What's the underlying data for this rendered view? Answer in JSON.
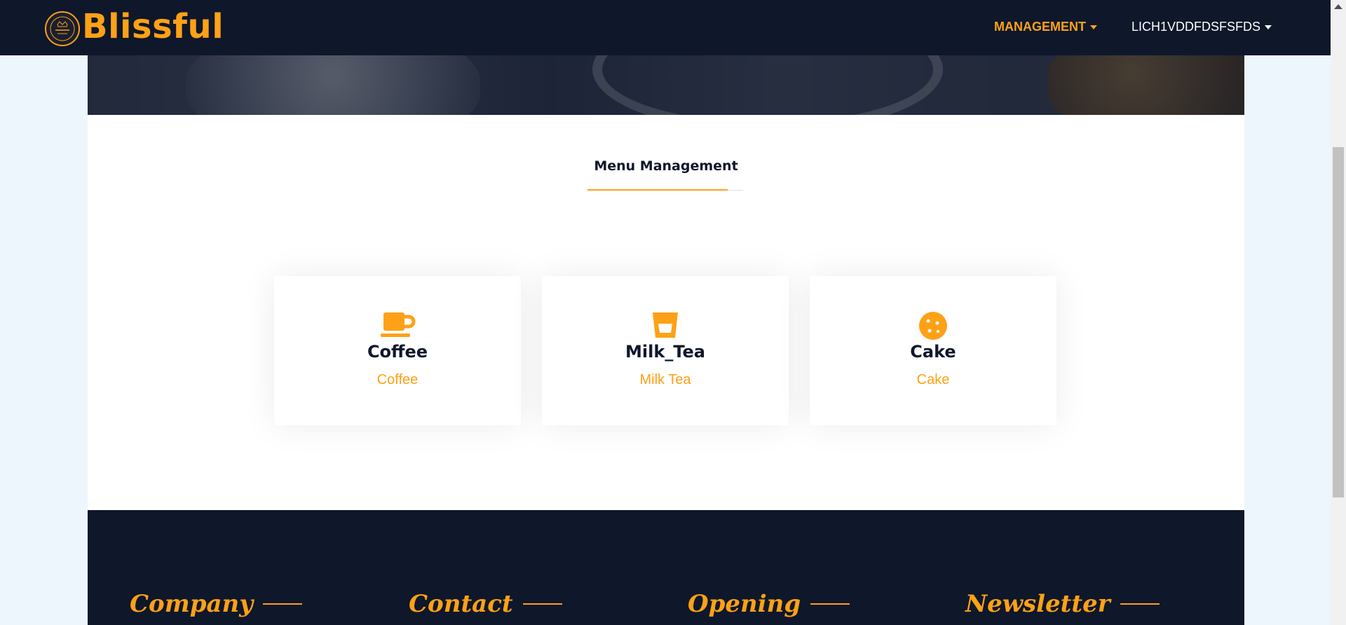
{
  "navbar": {
    "brand": "Blissful",
    "logo_icon": "blissful-crown-logo",
    "menu_management": "MANAGEMENT",
    "menu_user": "LICH1VDDFDSFSFDS"
  },
  "main": {
    "section_title": "Menu Management",
    "cards": [
      {
        "icon": "coffee-cup-icon",
        "title": "Coffee",
        "subtitle": "Coffee"
      },
      {
        "icon": "glass-icon",
        "title": "Milk_Tea",
        "subtitle": "Milk Tea"
      },
      {
        "icon": "cookie-icon",
        "title": "Cake",
        "subtitle": "Cake"
      }
    ]
  },
  "footer": {
    "headings": [
      "Company",
      "Contact",
      "Opening",
      "Newsletter"
    ]
  },
  "colors": {
    "primary": "#fea116",
    "dark": "#0f172b",
    "background": "#eef6fd"
  }
}
